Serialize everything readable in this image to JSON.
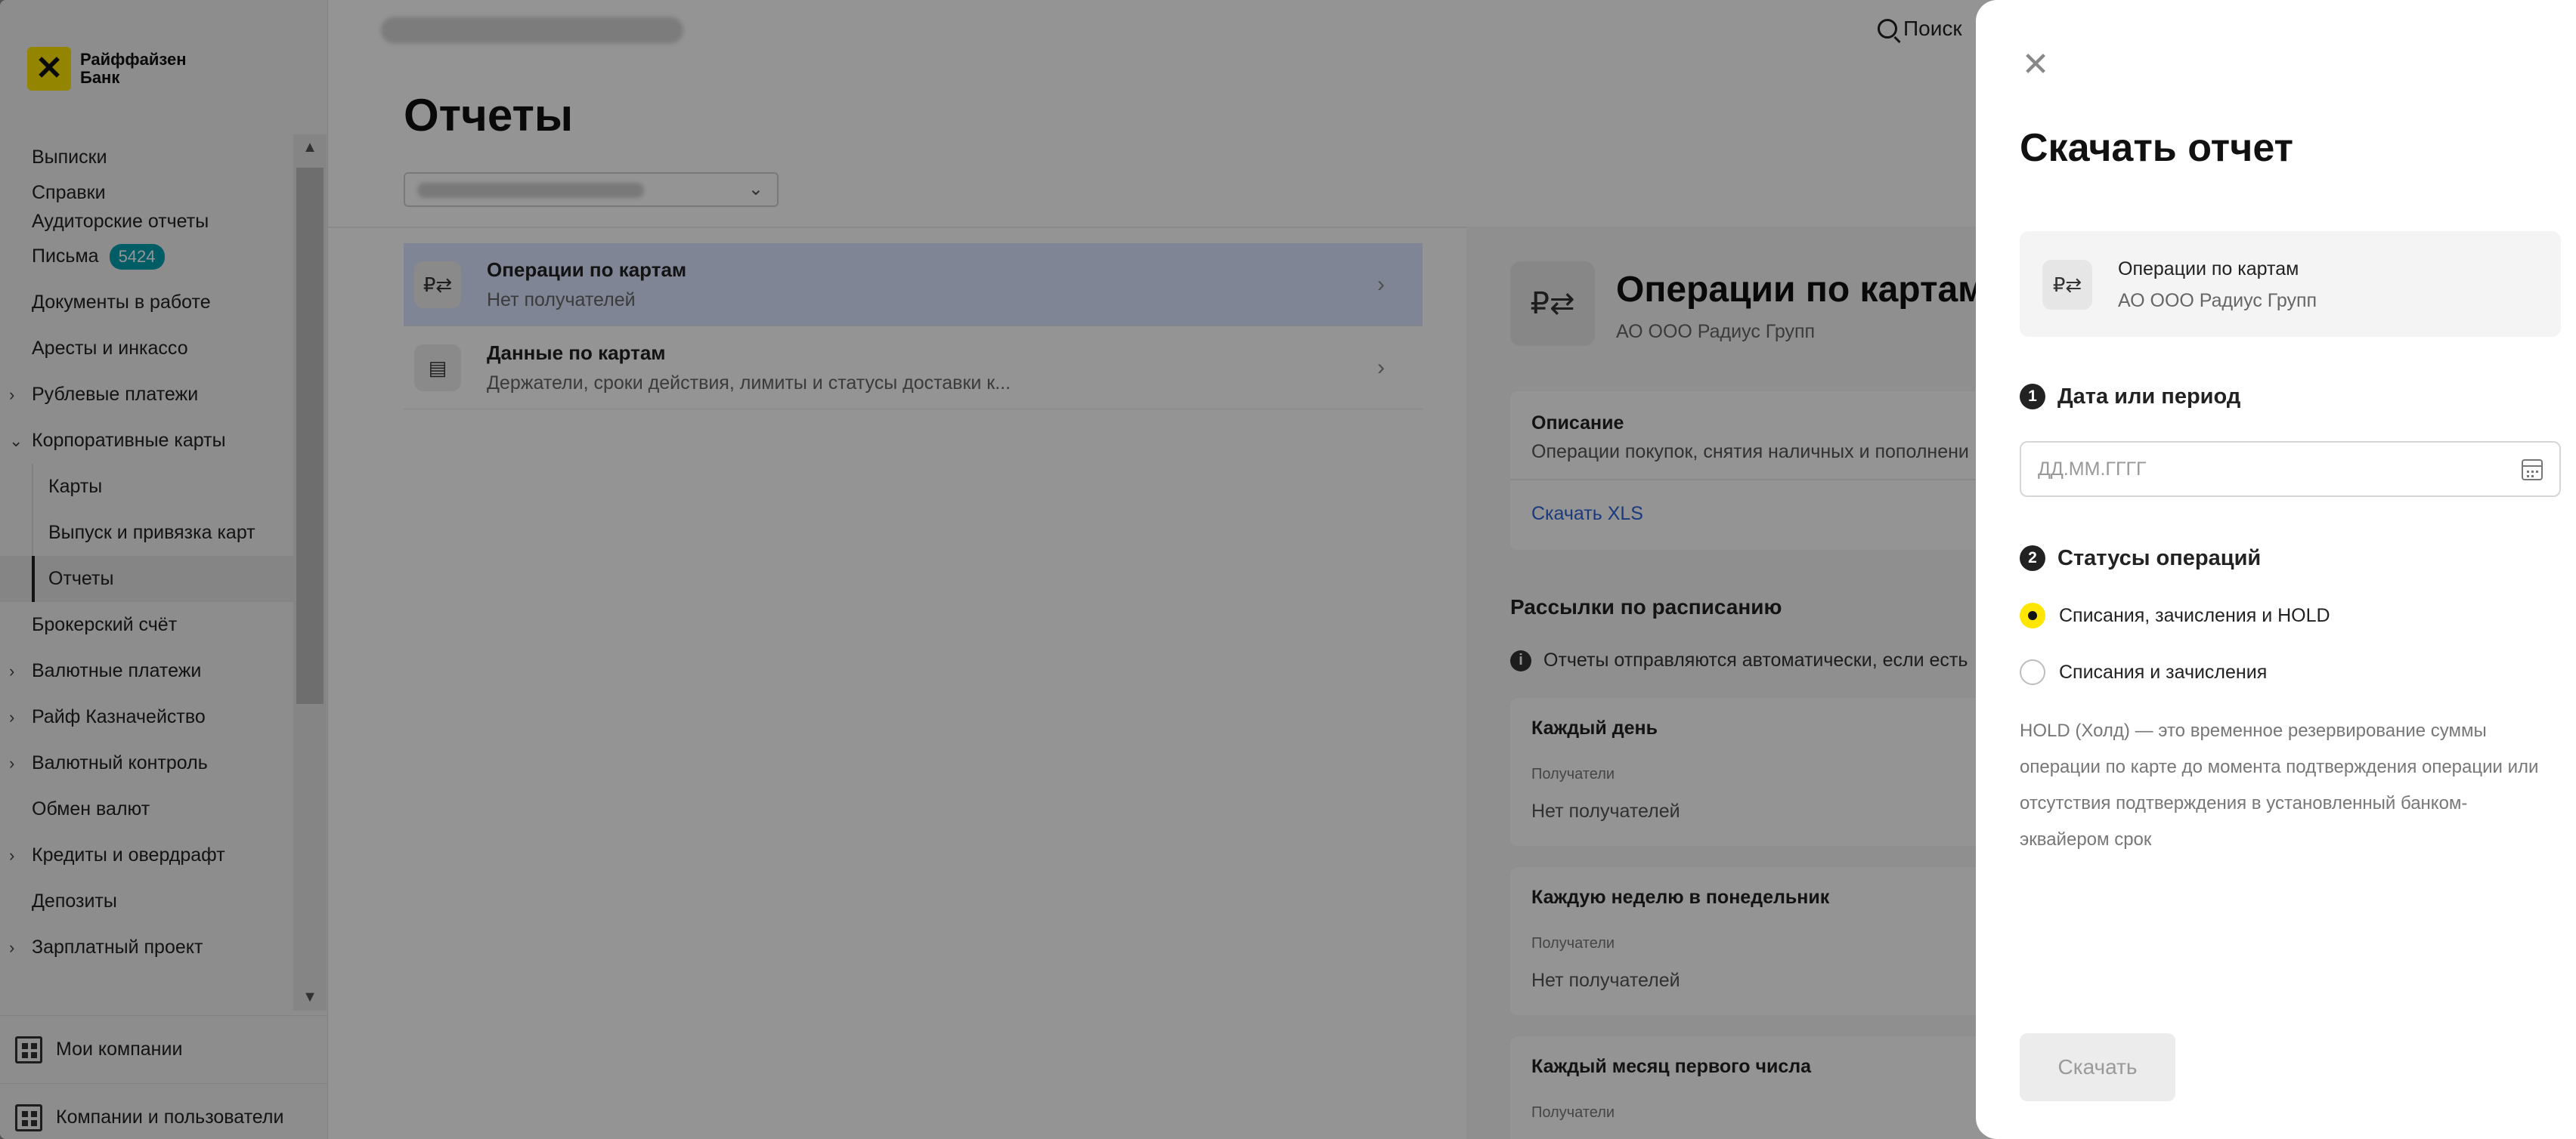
{
  "brand": {
    "name": "Райффайзен Банк",
    "accent": "#fee600"
  },
  "topbar": {
    "search_label": "Поиск"
  },
  "sidebar": {
    "items": [
      {
        "label": "Выписки",
        "chevron": ""
      },
      {
        "label": "Справки",
        "label2": "Аудиторские отчеты"
      },
      {
        "label": "Письма",
        "badge": "5424"
      },
      {
        "label": "Документы в работе"
      },
      {
        "label": "Аресты и инкассо"
      },
      {
        "label": "Рублевые платежи",
        "chevron": "›"
      },
      {
        "label": "Корпоративные карты",
        "chevron": "⌄"
      },
      {
        "label": "Карты"
      },
      {
        "label": "Выпуск и привязка карт"
      },
      {
        "label": "Отчеты"
      },
      {
        "label": "Брокерский счёт"
      },
      {
        "label": "Валютные платежи",
        "chevron": "›"
      },
      {
        "label": "Райф Казначейство",
        "chevron": "›"
      },
      {
        "label": "Валютный контроль",
        "chevron": "›"
      },
      {
        "label": "Обмен валют"
      },
      {
        "label": "Кредиты и овердрафт",
        "chevron": "›"
      },
      {
        "label": "Депозиты"
      },
      {
        "label": "Зарплатный проект",
        "chevron": "›"
      }
    ],
    "footer": [
      {
        "label": "Мои компании"
      },
      {
        "label": "Компании и пользователи"
      }
    ]
  },
  "main": {
    "title": "Отчеты",
    "reports": [
      {
        "title": "Операции по картам",
        "subtitle": "Нет получателей"
      },
      {
        "title": "Данные по картам",
        "subtitle": "Держатели, сроки действия, лимиты и статусы доставки к..."
      }
    ]
  },
  "detail": {
    "title": "Операции по картам",
    "subtitle": "АО ООО Радиус Групп",
    "description_label": "Описание",
    "description_text": "Операции покупок, снятия наличных и пополнени",
    "download_link": "Скачать XLS",
    "schedule_heading": "Рассылки по расписанию",
    "schedule_note": "Отчеты отправляются автоматически, если есть",
    "recipients_label": "Получатели",
    "schedules": [
      {
        "title": "Каждый день",
        "value": "Нет получателей"
      },
      {
        "title": "Каждую неделю в понедельник",
        "value": "Нет получателей"
      },
      {
        "title": "Каждый месяц первого числа",
        "value": ""
      }
    ]
  },
  "panel": {
    "title": "Скачать отчет",
    "report_card": {
      "title": "Операции по картам",
      "subtitle": "АО ООО Радиус Групп"
    },
    "step1": {
      "num": "1",
      "label": "Дата или период"
    },
    "date_placeholder": "ДД.ММ.ГГГГ",
    "date_value": "",
    "step2": {
      "num": "2",
      "label": "Статусы операций"
    },
    "options": [
      {
        "label": "Списания, зачисления и HOLD",
        "checked": true
      },
      {
        "label": "Списания и зачисления",
        "checked": false
      }
    ],
    "hold_note": "HOLD (Холд) — это временное резервирование суммы операции по карте до момента подтверждения операции или отсутствия подтверждения в установленный банком-эквайером срок",
    "download_button": "Скачать"
  }
}
